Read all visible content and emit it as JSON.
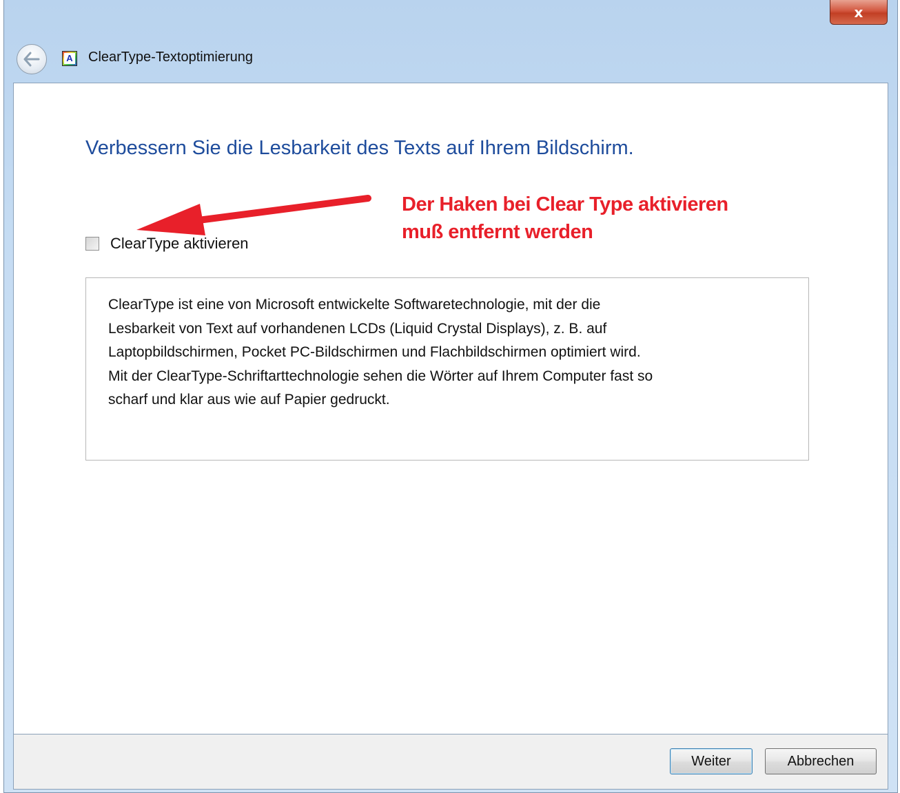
{
  "window": {
    "title": "ClearType-Textoptimierung",
    "close_label": "x"
  },
  "app_icon_letter": "A",
  "heading": "Verbessern Sie die Lesbarkeit des Texts auf Ihrem Bildschirm.",
  "checkbox": {
    "label": "ClearType aktivieren",
    "checked": false
  },
  "description": {
    "lines": [
      "ClearType ist eine von Microsoft entwickelte Softwaretechnologie, mit der die",
      "Lesbarkeit von Text auf vorhandenen LCDs (Liquid Crystal Displays), z. B. auf",
      "Laptopbildschirmen, Pocket PC-Bildschirmen und Flachbildschirmen optimiert wird.",
      "Mit der ClearType-Schriftarttechnologie sehen die Wörter auf Ihrem Computer fast so",
      "scharf und klar aus wie auf Papier gedruckt."
    ]
  },
  "annotation": {
    "line1": "Der Haken bei Clear Type aktivieren",
    "line2": "muß entfernt werden",
    "color": "#e8202a"
  },
  "footer": {
    "next_label": "Weiter",
    "cancel_label": "Abbrechen"
  },
  "colors": {
    "heading": "#1e4c9c",
    "accent_red": "#e8202a"
  }
}
